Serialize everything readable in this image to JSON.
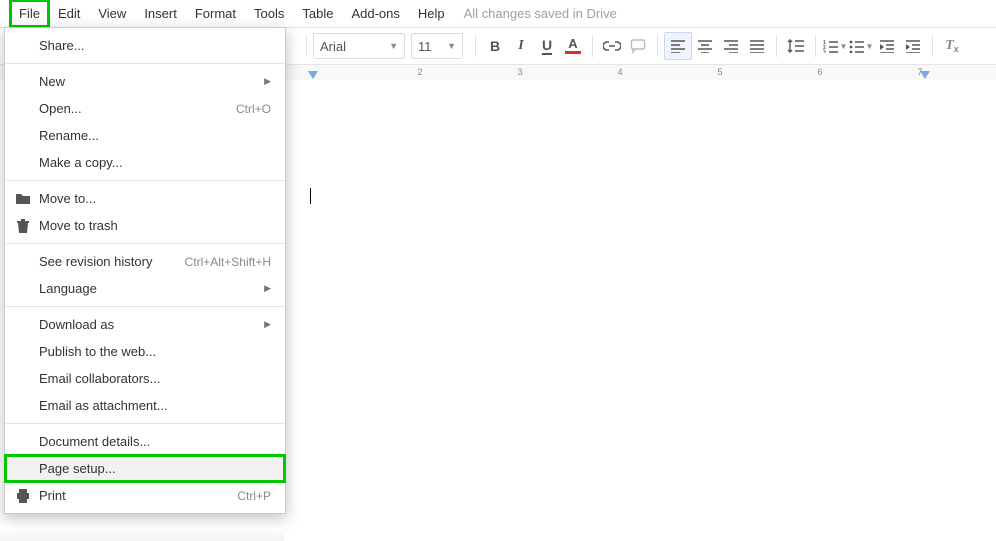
{
  "menubar": {
    "items": [
      "File",
      "Edit",
      "View",
      "Insert",
      "Format",
      "Tools",
      "Table",
      "Add-ons",
      "Help"
    ],
    "status": "All changes saved in Drive"
  },
  "toolbar": {
    "font": "Arial",
    "size": "11"
  },
  "dropdown": {
    "share": "Share...",
    "new": "New",
    "open": "Open...",
    "open_sc": "Ctrl+O",
    "rename": "Rename...",
    "makecopy": "Make a copy...",
    "moveto": "Move to...",
    "movetrash": "Move to trash",
    "revhist": "See revision history",
    "revhist_sc": "Ctrl+Alt+Shift+H",
    "language": "Language",
    "downloadas": "Download as",
    "publish": "Publish to the web...",
    "emailcollab": "Email collaborators...",
    "emailattach": "Email as attachment...",
    "docdetails": "Document details...",
    "pagesetup": "Page setup...",
    "print": "Print",
    "print_sc": "Ctrl+P"
  },
  "ruler": {
    "numbers": [
      "2",
      "3",
      "4",
      "5",
      "6",
      "7"
    ]
  }
}
